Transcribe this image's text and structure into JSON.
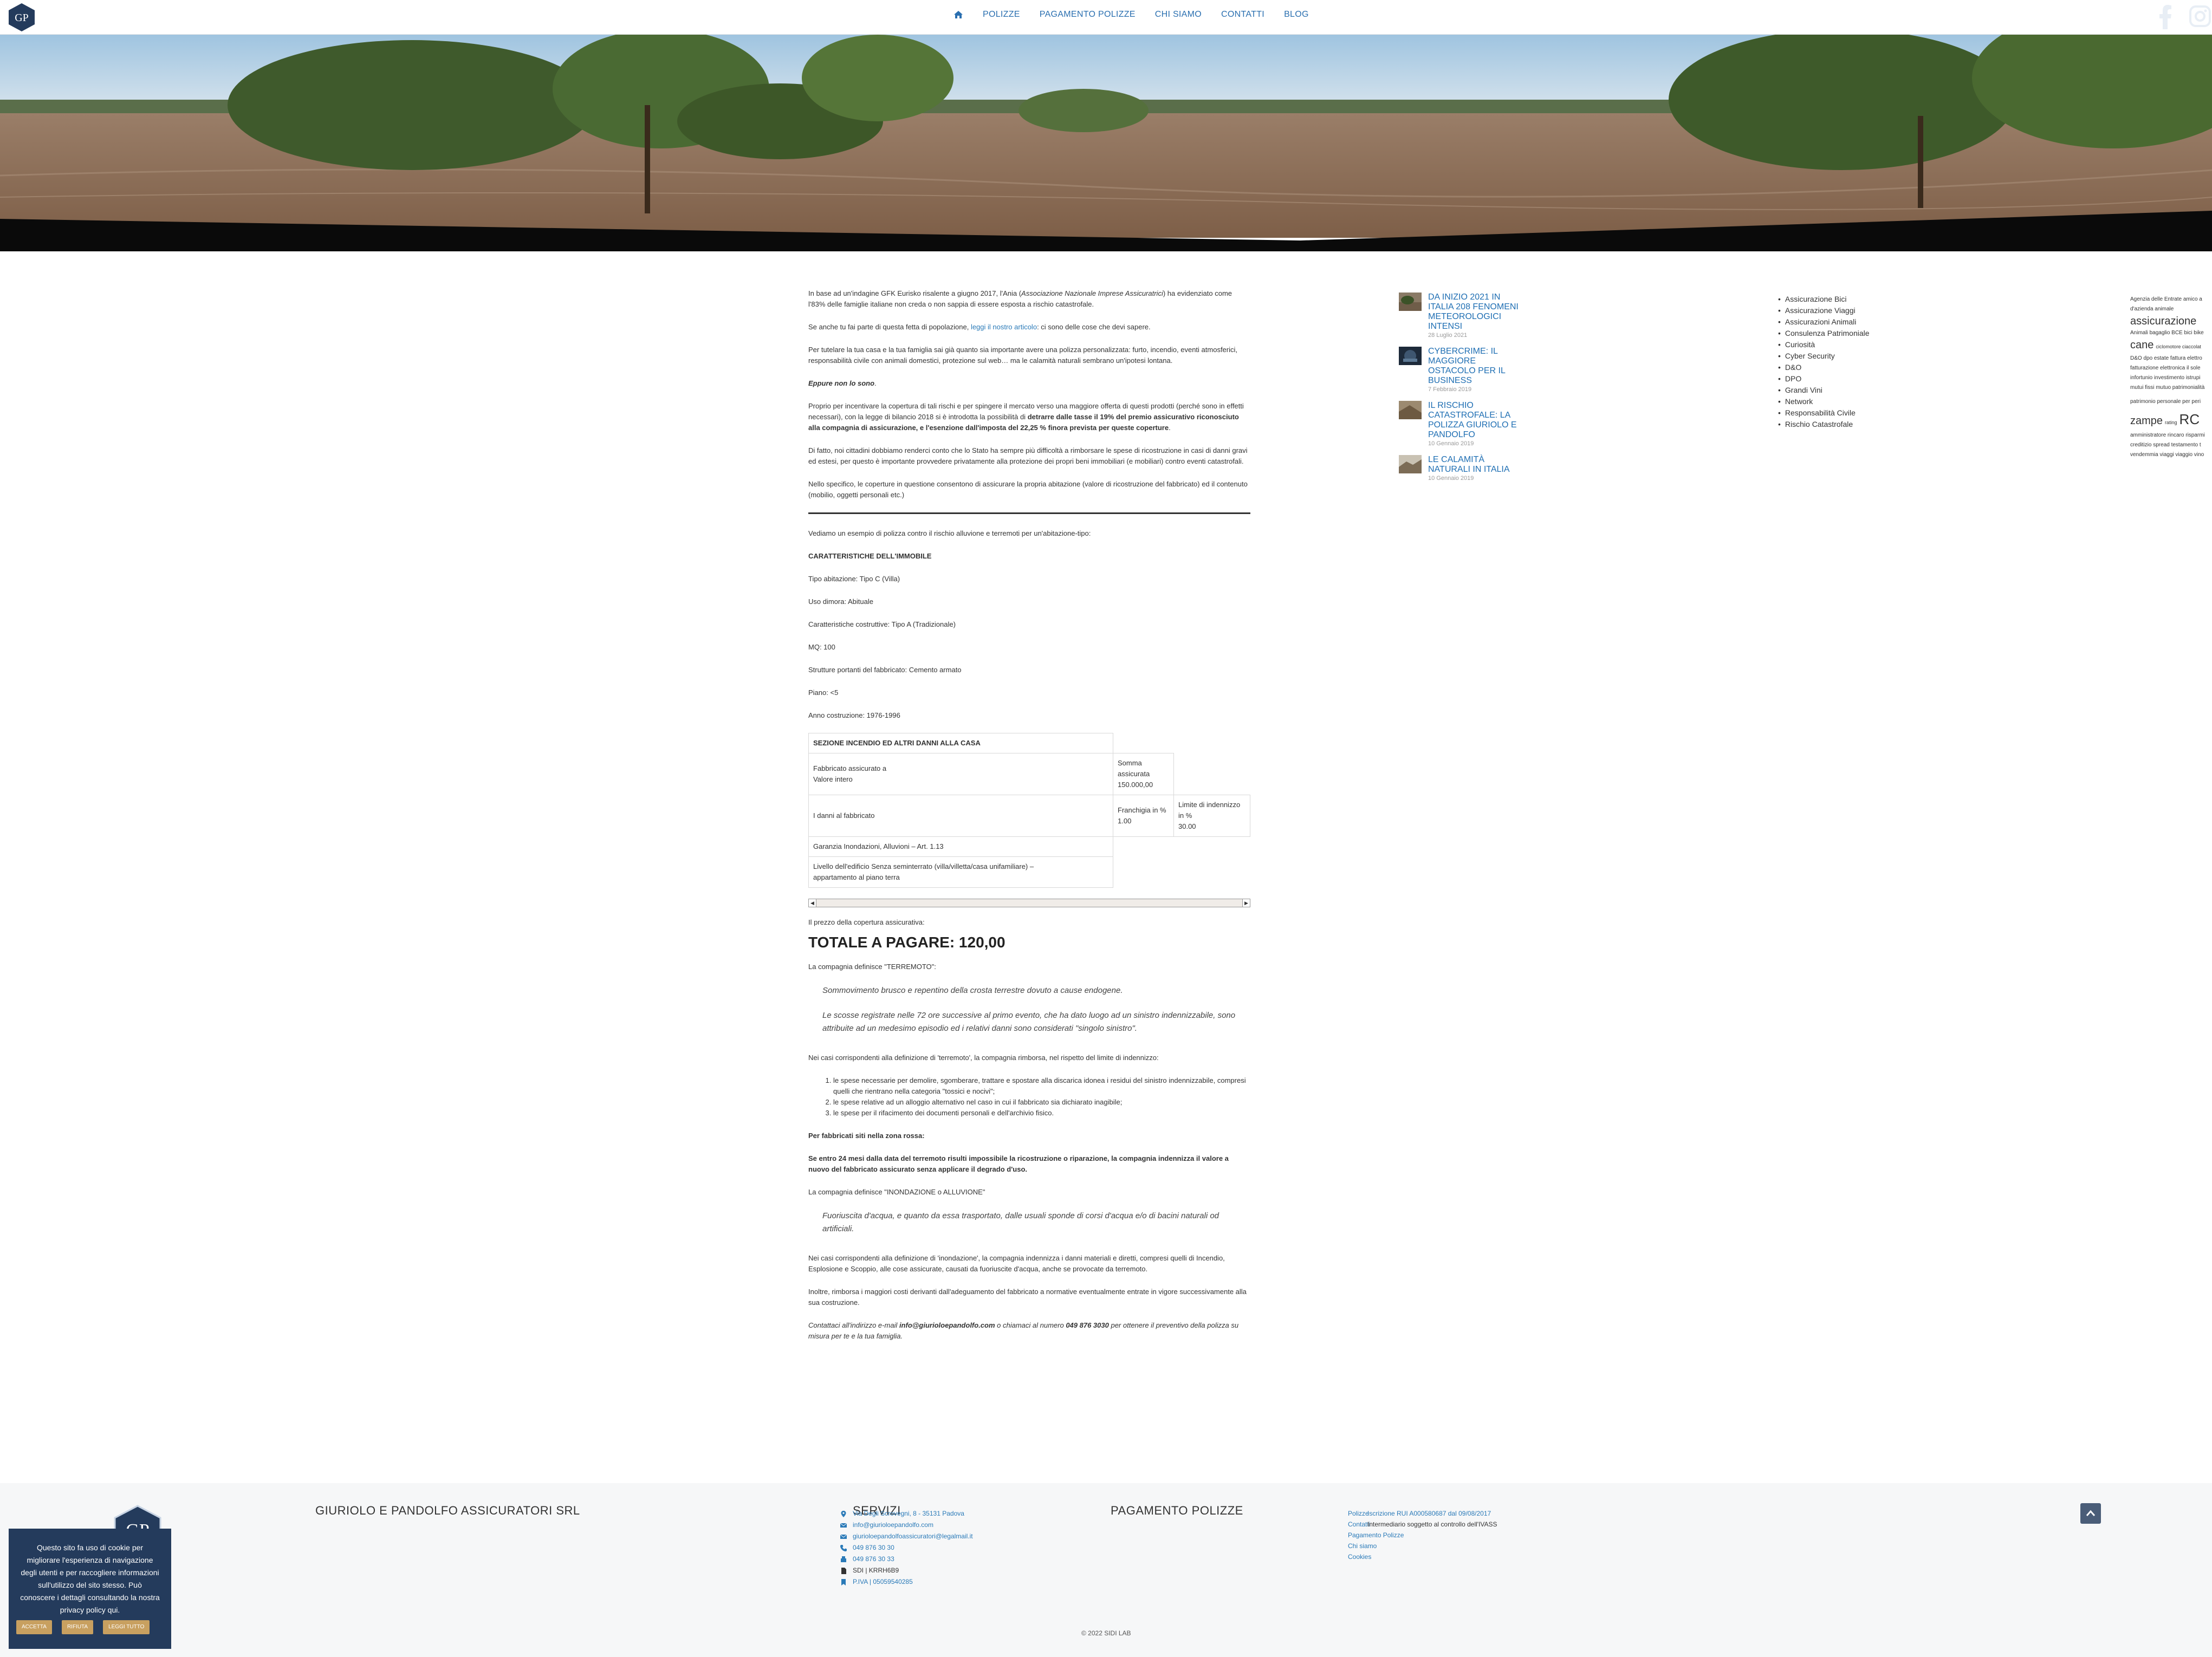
{
  "header": {
    "nav": [
      "Polizze",
      "Pagamento Polizze",
      "Chi siamo",
      "Contatti",
      "Blog"
    ]
  },
  "article": {
    "p1_a": "In base ad un'indagine GFK Eurisko risalente a giugno 2017, l'Ania (",
    "p1_b": "Associazione Nazionale Imprese Assicuratrici",
    "p1_c": ") ha evidenziato come l'83% delle famiglie italiane non creda o non sappia di essere esposta a rischio catastrofale.",
    "p2_a": "Se anche tu fai parte di questa fetta di popolazione, ",
    "p2_link": "leggi il nostro articolo",
    "p2_b": ": ci sono delle cose che devi sapere.",
    "p3": "Per tutelare la tua casa e la tua famiglia sai già quanto sia importante avere una polizza personalizzata: furto, incendio, eventi atmosferici, responsabilità civile con animali domestici, protezione sul web… ma le calamità naturali sembrano un'ipotesi lontana.",
    "p4": "Eppure non lo sono",
    "p5_a": "Proprio per incentivare la copertura di tali rischi e per spingere il mercato verso una maggiore offerta di questi prodotti (perché sono in effetti necessari), con la legge di bilancio 2018 si è introdotta la possibilità di ",
    "p5_b": "detrarre dalle tasse il 19% del premio assicurativo riconosciuto alla compagnia di assicurazione, e l'esenzione dall'imposta del 22,25 % finora prevista per queste coperture",
    "p6": "Di fatto, noi cittadini dobbiamo renderci conto che lo Stato ha sempre più difficoltà a rimborsare le spese di ricostruzione in casi di danni gravi ed estesi, per questo è importante provvedere privatamente alla protezione dei propri beni immobiliari (e mobiliari) contro eventi catastrofali.",
    "p7": "Nello specifico, le coperture in questione consentono di assicurare la propria abitazione (valore di ricostruzione del fabbricato) ed il contenuto (mobilio, oggetti personali etc.)",
    "p8": "Vediamo un esempio di polizza contro il rischio alluvione e terremoti per un'abitazione-tipo:",
    "car_title": "CARATTERISTICHE DELL'IMMOBILE",
    "specs": [
      "Tipo abitazione: Tipo  C (Villa)",
      "Uso dimora: Abituale",
      "Caratteristiche costruttive: Tipo A (Tradizionale)",
      "MQ: 100",
      "Strutture portanti del fabbricato: Cemento armato",
      "Piano: <5",
      "Anno costruzione: 1976-1996"
    ],
    "table": {
      "header": "SEZIONE INCENDIO ED ALTRI DANNI ALLA CASA",
      "r1c1a": "Fabbricato assicurato a",
      "r1c1b": "Valore intero",
      "r1c2a": "Somma",
      "r1c2b": "assicurata",
      "r1c2c": "150.000,00",
      "r2c1": "I danni al fabbricato",
      "r2c2a": "Franchigia in %",
      "r2c2b": "1.00",
      "r2c3a": "Limite di indennizzo",
      "r2c3b": "in %",
      "r2c3c": "30.00",
      "r3c1": "Garanzia Inondazioni, Alluvioni – Art. 1.13",
      "r4c1a": "Livello dell'edificio Senza seminterrato (villa/villetta/casa unifamiliare) –",
      "r4c1b": "appartamento al piano terra"
    },
    "prezzo": "Il prezzo della copertura assicurativa:",
    "totale": "TOTALE A PAGARE: 120,00",
    "def_terremoto": "La compagnia definisce \"TERREMOTO\":",
    "quote1_a": "Sommovimento brusco e repentino della crosta terrestre dovuto a cause endogene.",
    "quote1_b": "Le scosse registrate nelle 72 ore successive al primo evento, che ha dato luogo ad un sinistro indennizzabile, sono attribuite ad un medesimo episodio ed i relativi danni sono considerati \"singolo sinistro\".",
    "casi_terremoto": "Nei casi corrispondenti alla definizione di 'terremoto', la compagnia rimborsa, nel rispetto del limite di indennizzo:",
    "spese": [
      "le spese necessarie per demolire, sgomberare, trattare e spostare alla discarica idonea i residui del sinistro indennizzabile, compresi quelli che rientrano nella categoria \"tossici e nocivi\";",
      "le spese relative ad un alloggio alternativo nel caso in cui il fabbricato sia dichiarato inagibile;",
      "le spese per il rifacimento dei documenti personali e dell'archivio fisico."
    ],
    "zona_rossa": "Per fabbricati siti nella zona rossa:",
    "entro24": "Se entro 24 mesi dalla data del terremoto risulti impossibile la ricostruzione o riparazione, la compagnia indennizza il valore a nuovo del fabbricato assicurato senza applicare il degrado d'uso.",
    "def_inondazione": "La compagnia definisce \"INONDAZIONE o ALLUVIONE\"",
    "quote2": "Fuoriuscita d'acqua, e quanto da essa trasportato, dalle usuali sponde di corsi d'acqua e/o di bacini naturali od artificiali.",
    "casi_inondazione": "Nei casi corrispondenti alla definizione di 'inondazione', la compagnia indennizza i danni materiali e diretti, compresi quelli di Incendio, Esplosione e Scoppio, alle cose assicurate, causati da fuoriuscite d'acqua, anche se provocate da terremoto.",
    "inoltre": "Inoltre, rimborsa i maggiori costi derivanti dall'adeguamento del fabbricato a normative eventualmente entrate in vigore successivamente alla sua costruzione.",
    "contact_a": "Contattaci all'indirizzo e-mail ",
    "contact_email": "info@giurioloepandolfo.com",
    "contact_b": " o chiamaci al numero ",
    "contact_phone": "049 876 3030",
    "contact_c": " per ottenere il preventivo della polizza su misura per te e la tua famiglia."
  },
  "recent_posts": [
    {
      "title": "Da inizio 2021 in Italia 208 fenomeni meteorologici intensi",
      "date": "28 Luglio 2021",
      "icon": "flood-thumb"
    },
    {
      "title": "CYBERCRIME: IL MAGGIORE OSTACOLO PER IL BUSINESS",
      "date": "7 Febbraio 2019",
      "icon": "cyber-thumb"
    },
    {
      "title": "Il rischio catastrofale: la polizza Giuriolo e Pandolfo",
      "date": "10 Gennaio 2019",
      "icon": "flood-thumb"
    },
    {
      "title": "Le calamità naturali in Italia",
      "date": "10 Gennaio 2019",
      "icon": "landscape-thumb"
    }
  ],
  "categories": [
    "Assicurazione Bici",
    "Assicurazione Viaggi",
    "Assicurazioni Animali",
    "Consulenza Patrimoniale",
    "Curiosità",
    "Cyber Security",
    "D&O",
    "DPO",
    "Grandi Vini",
    "Network",
    "Responsabilità Civile",
    "Rischio Catastrofale"
  ],
  "tag_cloud": {
    "line1": "Agenzia delle Entrate amico a",
    "line2": "d'azienda animale",
    "line3": "assicurazione",
    "line4": "Animali bagaglio BCE bici bike",
    "line5a": "cane",
    "line5b": "ciclomotore ciaccolat",
    "line6": "D&O dpo estate fattura elettro",
    "line7": "fatturazione elettronica il sole",
    "line8": "infortunio investimento istrupi",
    "line9": "mutui fissi mutuo patrimonialità",
    "line10": "patrimonio personale per peri",
    "line11a": "zampe",
    "line11b": "rating",
    "line11c": "RC",
    "line12": "amministratore rincaro risparmi",
    "line13": "creditizio spread testamento t",
    "line14": "vendemmia viaggi viaggio vino"
  },
  "footer": {
    "brand": "GIURIOLO E PANDOLFO ASSICURATORI SRL",
    "servizi": "SERVIZI",
    "pagamento": "PAGAMENTO POLIZZE",
    "contacts": [
      {
        "icon": "map-pin-icon",
        "text": "Via Degli Scrovegni, 8 - 35131 Padova",
        "link": true
      },
      {
        "icon": "email-icon",
        "text": "info@giurioloepandolfo.com",
        "link": true
      },
      {
        "icon": "email-icon",
        "text": "giurioloepandolfoassicuratori@legalmail.it",
        "link": true
      },
      {
        "icon": "phone-icon",
        "text": "049 876 30 30",
        "link": true
      },
      {
        "icon": "fax-icon",
        "text": "049 876 30 33",
        "link": true
      },
      {
        "icon": "document-icon",
        "text": "SDI | KRRH6B9",
        "link": false
      },
      {
        "icon": "bookmark-icon",
        "text": "P.IVA | 05059540285",
        "link": true
      }
    ],
    "links": [
      "Polizze",
      "Contatti",
      "Pagamento Polizze",
      "Chi siamo",
      "Cookies"
    ],
    "iscrizione": "Iscrizione RUI A000580687 dal 09/08/2017",
    "intermediario": "Intermediario soggetto al controllo dell'IVASS",
    "copyright": "© 2022 SIDI LAB"
  },
  "cookie": {
    "text": "Questo sito fa uso di cookie per migliorare l'esperienza di navigazione degli utenti e per raccogliere informazioni sull'utilizzo del sito stesso. Può conoscere i dettagli consultando la nostra privacy policy qui.",
    "accept": "Accetta",
    "reject": "Rifiuta",
    "accept_all": "Leggi tutto"
  },
  "colors": {
    "accent": "#2a7ab8",
    "navy": "#243b5c",
    "gold": "#c8a060"
  }
}
